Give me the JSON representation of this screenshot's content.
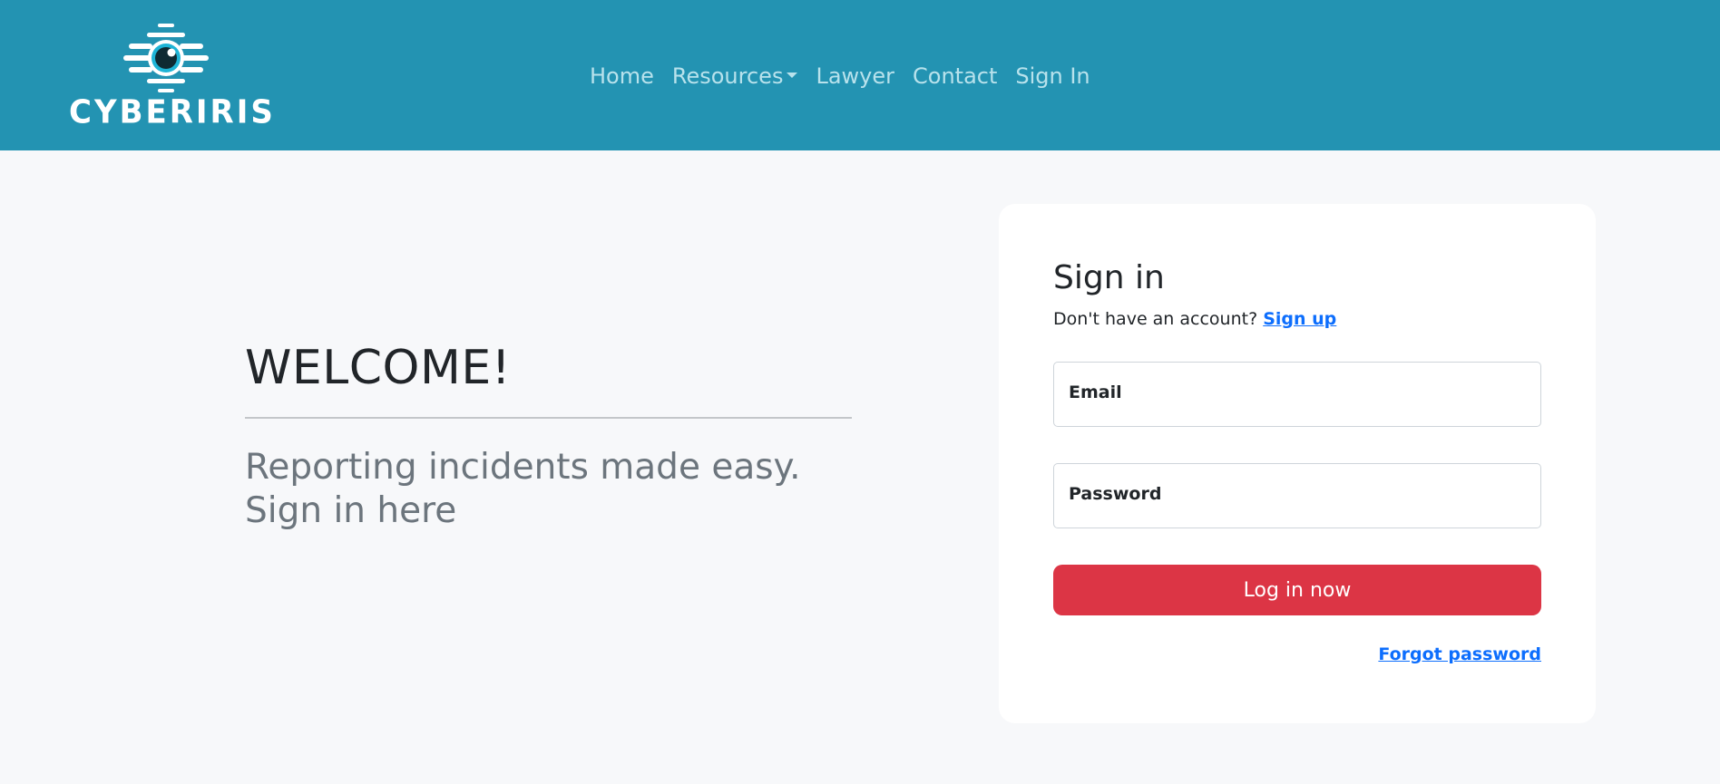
{
  "brand": {
    "name": "CYBERIRIS",
    "logo_icon": "eye-icon",
    "colors": {
      "navbar_bg": "#2393b2",
      "logo_white": "#ffffff",
      "logo_pupil": "#0f2a33"
    }
  },
  "nav": {
    "items": [
      {
        "label": "Home"
      },
      {
        "label": "Resources",
        "has_dropdown": true
      },
      {
        "label": "Lawyer"
      },
      {
        "label": "Contact"
      },
      {
        "label": "Sign In"
      }
    ],
    "link_color": "#b8e2ec"
  },
  "hero": {
    "title": "WELCOME!",
    "lead_line1": "Reporting incidents made easy.",
    "lead_line2": "Sign in here"
  },
  "signin": {
    "title": "Sign in",
    "no_account_text": "Don't have an account?",
    "signup_link": "Sign up",
    "email_label": "Email",
    "password_label": "Password",
    "login_button": "Log in now",
    "forgot_link": "Forgot password",
    "colors": {
      "button_bg": "#dc3545",
      "link": "#0d6efd"
    }
  }
}
